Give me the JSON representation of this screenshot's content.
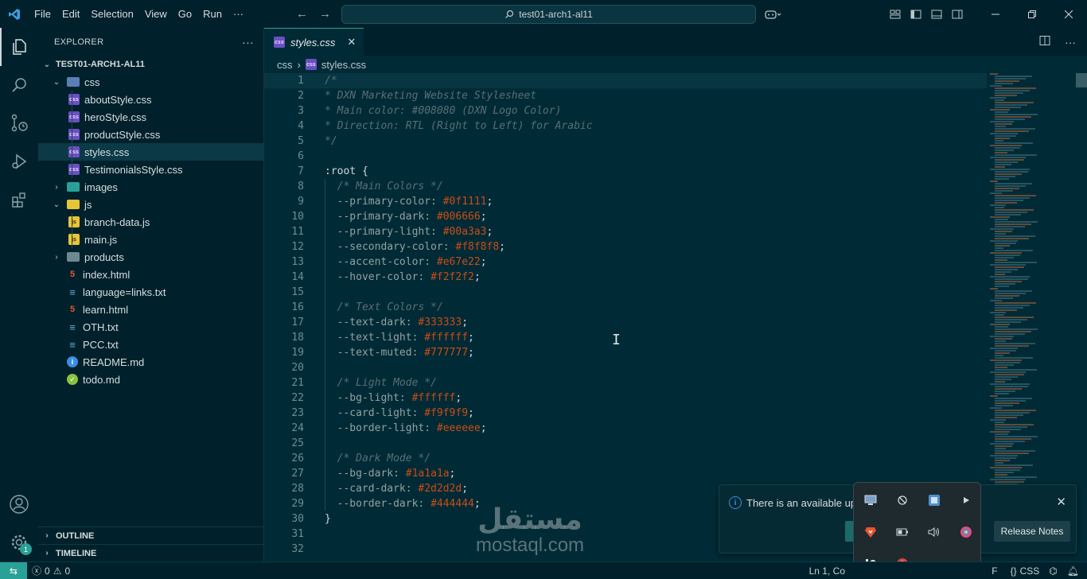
{
  "titlebar": {
    "menu": [
      "File",
      "Edit",
      "Selection",
      "View",
      "Go",
      "Run",
      "···"
    ],
    "search_text": "test01-arch1-al11"
  },
  "explorer": {
    "title": "EXPLORER",
    "more": "···",
    "root": "TEST01-ARCH1-AL11",
    "tree": [
      {
        "label": "css",
        "kind": "folder-css",
        "depth": 1,
        "open": true
      },
      {
        "label": "aboutStyle.css",
        "kind": "css",
        "depth": 2
      },
      {
        "label": "heroStyle.css",
        "kind": "css",
        "depth": 2
      },
      {
        "label": "productStyle.css",
        "kind": "css",
        "depth": 2
      },
      {
        "label": "styles.css",
        "kind": "css",
        "depth": 2,
        "selected": true
      },
      {
        "label": "TestimonialsStyle.css",
        "kind": "css",
        "depth": 2
      },
      {
        "label": "images",
        "kind": "folder-img",
        "depth": 1,
        "open": false
      },
      {
        "label": "js",
        "kind": "folder-js",
        "depth": 1,
        "open": true
      },
      {
        "label": "branch-data.js",
        "kind": "js",
        "depth": 2
      },
      {
        "label": "main.js",
        "kind": "js",
        "depth": 2
      },
      {
        "label": "products",
        "kind": "folder",
        "depth": 1,
        "open": false
      },
      {
        "label": "index.html",
        "kind": "html",
        "depth": 1
      },
      {
        "label": "language=links.txt",
        "kind": "txt",
        "depth": 1
      },
      {
        "label": "learn.html",
        "kind": "html",
        "depth": 1
      },
      {
        "label": "OTH.txt",
        "kind": "txt",
        "depth": 1
      },
      {
        "label": "PCC.txt",
        "kind": "txt",
        "depth": 1
      },
      {
        "label": "README.md",
        "kind": "info",
        "depth": 1
      },
      {
        "label": "todo.md",
        "kind": "check",
        "depth": 1
      }
    ],
    "outline": "OUTLINE",
    "timeline": "TIMELINE"
  },
  "editor": {
    "tab_label": "styles.css",
    "breadcrumb": [
      "css",
      "styles.css"
    ],
    "lines": [
      {
        "n": "1",
        "parts": [
          {
            "t": "/*",
            "c": "comment"
          }
        ]
      },
      {
        "n": "2",
        "parts": [
          {
            "t": "* DXN Marketing Website Stylesheet",
            "c": "comment"
          }
        ]
      },
      {
        "n": "3",
        "parts": [
          {
            "t": "* Main color: #008080 (DXN Logo Color)",
            "c": "comment"
          }
        ]
      },
      {
        "n": "4",
        "parts": [
          {
            "t": "* Direction: RTL (Right to Left) for Arabic",
            "c": "comment"
          }
        ]
      },
      {
        "n": "5",
        "parts": [
          {
            "t": "*/",
            "c": "comment"
          }
        ]
      },
      {
        "n": "6",
        "parts": []
      },
      {
        "n": "7",
        "parts": [
          {
            "t": ":root {",
            "c": "sel"
          }
        ]
      },
      {
        "n": "8",
        "parts": [
          {
            "t": "  /* Main Colors */",
            "c": "comment"
          }
        ]
      },
      {
        "n": "9",
        "parts": [
          {
            "t": "  --primary-color: ",
            "c": "prop"
          },
          {
            "t": "#0f1111",
            "c": "val"
          },
          {
            "t": ";",
            "c": "sel"
          }
        ]
      },
      {
        "n": "10",
        "parts": [
          {
            "t": "  --primary-dark: ",
            "c": "prop"
          },
          {
            "t": "#006666",
            "c": "val"
          },
          {
            "t": ";",
            "c": "sel"
          }
        ]
      },
      {
        "n": "11",
        "parts": [
          {
            "t": "  --primary-light: ",
            "c": "prop"
          },
          {
            "t": "#00a3a3",
            "c": "val"
          },
          {
            "t": ";",
            "c": "sel"
          }
        ]
      },
      {
        "n": "12",
        "parts": [
          {
            "t": "  --secondary-color: ",
            "c": "prop"
          },
          {
            "t": "#f8f8f8",
            "c": "val"
          },
          {
            "t": ";",
            "c": "sel"
          }
        ]
      },
      {
        "n": "13",
        "parts": [
          {
            "t": "  --accent-color: ",
            "c": "prop"
          },
          {
            "t": "#e67e22",
            "c": "val"
          },
          {
            "t": ";",
            "c": "sel"
          }
        ]
      },
      {
        "n": "14",
        "parts": [
          {
            "t": "  --hover-color: ",
            "c": "prop"
          },
          {
            "t": "#f2f2f2",
            "c": "val"
          },
          {
            "t": ";",
            "c": "sel"
          }
        ]
      },
      {
        "n": "15",
        "parts": []
      },
      {
        "n": "16",
        "parts": [
          {
            "t": "  /* Text Colors */",
            "c": "comment"
          }
        ]
      },
      {
        "n": "17",
        "parts": [
          {
            "t": "  --text-dark: ",
            "c": "prop"
          },
          {
            "t": "#333333",
            "c": "val"
          },
          {
            "t": ";",
            "c": "sel"
          }
        ]
      },
      {
        "n": "18",
        "parts": [
          {
            "t": "  --text-light: ",
            "c": "prop"
          },
          {
            "t": "#ffffff",
            "c": "val"
          },
          {
            "t": ";",
            "c": "sel"
          }
        ]
      },
      {
        "n": "19",
        "parts": [
          {
            "t": "  --text-muted: ",
            "c": "prop"
          },
          {
            "t": "#777777",
            "c": "val"
          },
          {
            "t": ";",
            "c": "sel"
          }
        ]
      },
      {
        "n": "20",
        "parts": []
      },
      {
        "n": "21",
        "parts": [
          {
            "t": "  /* Light Mode */",
            "c": "comment"
          }
        ]
      },
      {
        "n": "22",
        "parts": [
          {
            "t": "  --bg-light: ",
            "c": "prop"
          },
          {
            "t": "#ffffff",
            "c": "val"
          },
          {
            "t": ";",
            "c": "sel"
          }
        ]
      },
      {
        "n": "23",
        "parts": [
          {
            "t": "  --card-light: ",
            "c": "prop"
          },
          {
            "t": "#f9f9f9",
            "c": "val"
          },
          {
            "t": ";",
            "c": "sel"
          }
        ]
      },
      {
        "n": "24",
        "parts": [
          {
            "t": "  --border-light: ",
            "c": "prop"
          },
          {
            "t": "#eeeeee",
            "c": "val"
          },
          {
            "t": ";",
            "c": "sel"
          }
        ]
      },
      {
        "n": "25",
        "parts": []
      },
      {
        "n": "26",
        "parts": [
          {
            "t": "  /* Dark Mode */",
            "c": "comment"
          }
        ]
      },
      {
        "n": "27",
        "parts": [
          {
            "t": "  --bg-dark: ",
            "c": "prop"
          },
          {
            "t": "#1a1a1a",
            "c": "val"
          },
          {
            "t": ";",
            "c": "sel"
          }
        ]
      },
      {
        "n": "28",
        "parts": [
          {
            "t": "  --card-dark: ",
            "c": "prop"
          },
          {
            "t": "#2d2d2d",
            "c": "val"
          },
          {
            "t": ";",
            "c": "sel"
          }
        ]
      },
      {
        "n": "29",
        "parts": [
          {
            "t": "  --border-dark: ",
            "c": "prop"
          },
          {
            "t": "#444444",
            "c": "val"
          },
          {
            "t": ";",
            "c": "sel"
          }
        ]
      },
      {
        "n": "30",
        "parts": [
          {
            "t": "}",
            "c": "sel"
          }
        ]
      },
      {
        "n": "31",
        "parts": []
      },
      {
        "n": "32",
        "parts": []
      }
    ]
  },
  "notification": {
    "message": "There is an available upd",
    "release_notes": "Release Notes"
  },
  "watermark": {
    "arabic": "مستقل",
    "latin": "mostaql.com"
  },
  "statusbar": {
    "errors": "0",
    "warnings": "0",
    "position": "Ln 1, Co",
    "eol": "F",
    "language": "CSS"
  },
  "badges": {
    "settings_count": "1"
  },
  "colors": {
    "accent": "#2aa198",
    "editor_bg": "#002b36",
    "value": "#cb4b16",
    "comment": "#586e75"
  }
}
